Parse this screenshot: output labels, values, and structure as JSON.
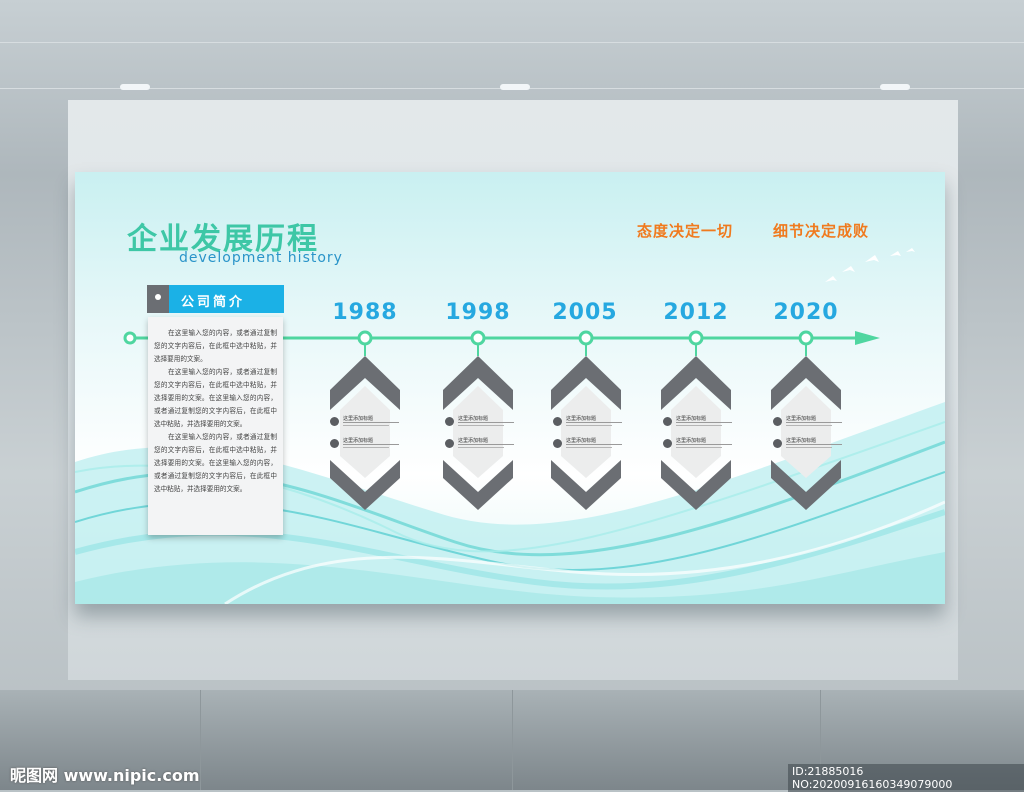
{
  "title_cn": "企业发展历程",
  "title_en": "development history",
  "slogans": [
    "态度决定一切",
    "细节决定成败"
  ],
  "intro": {
    "tab_label": "公司简介",
    "paragraphs": [
      "在这里输入您的内容，或者通过复制您的文字内容后，在此框中选中粘贴，并选择要用的文案。",
      "在这里输入您的内容，或者通过复制您的文字内容后，在此框中选中粘贴，并选择要用的文案。在这里输入您的内容，或者通过复制您的文字内容后，在此框中选中粘贴，并选择要用的文案。",
      "在这里输入您的内容，或者通过复制您的文字内容后，在此框中选中粘贴，并选择要用的文案。在这里输入您的内容，或者通过复制您的文字内容后，在此框中选中粘贴，并选择要用的文案。"
    ]
  },
  "milestones": [
    {
      "year": "1988",
      "items": [
        "这里添加标题",
        "这里添加标题"
      ]
    },
    {
      "year": "1998",
      "items": [
        "这里添加标题",
        "这里添加标题"
      ]
    },
    {
      "year": "2005",
      "items": [
        "这里添加标题",
        "这里添加标题"
      ]
    },
    {
      "year": "2012",
      "items": [
        "这里添加标题",
        "这里添加标题"
      ]
    },
    {
      "year": "2020",
      "items": [
        "这里添加标题",
        "这里添加标题"
      ]
    }
  ],
  "watermark": "昵图网 www.nipic.com",
  "image_id": "ID:21885016 NO:20200916160349079000",
  "colors": {
    "accent_green": "#3ec7a6",
    "accent_blue": "#26a8e0",
    "slogan_orange": "#f07a1e",
    "line_green": "#4fd6a0",
    "hex_gray": "#6b6e73"
  }
}
